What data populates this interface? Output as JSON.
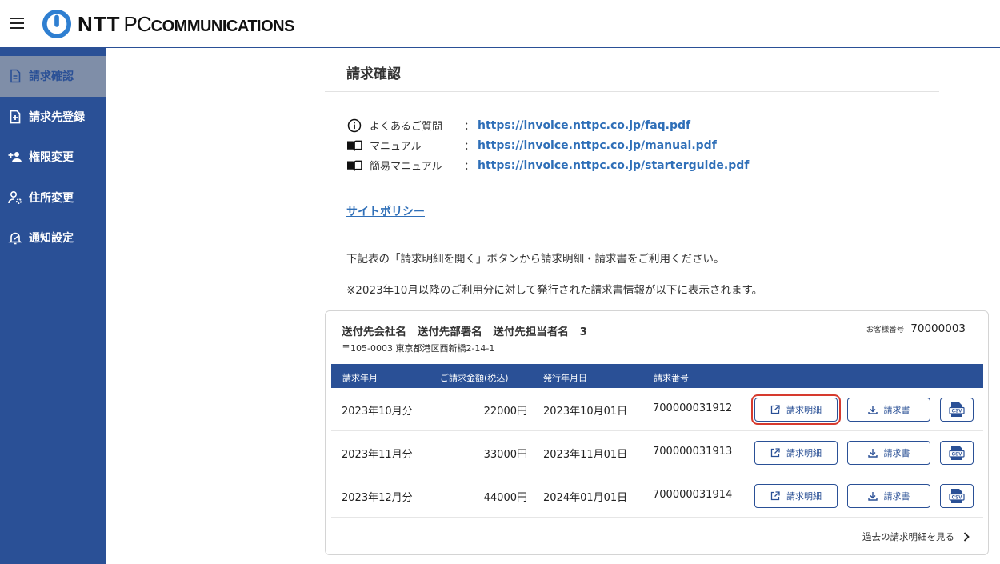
{
  "header": {
    "logo_ntt": "NTT",
    "logo_pc": "PC",
    "logo_comm": "COMMUNICATIONS"
  },
  "sidebar": {
    "items": [
      {
        "label": "請求確認",
        "icon": "document-icon"
      },
      {
        "label": "請求先登録",
        "icon": "add-document-icon"
      },
      {
        "label": "権限変更",
        "icon": "add-user-icon"
      },
      {
        "label": "住所変更",
        "icon": "user-settings-icon"
      },
      {
        "label": "通知設定",
        "icon": "bell-icon"
      }
    ]
  },
  "main": {
    "title": "請求確認",
    "links": [
      {
        "label": "よくあるご質問",
        "sep": "：",
        "url": "https://invoice.nttpc.co.jp/faq.pdf",
        "icon": "info-icon"
      },
      {
        "label": "マニュアル",
        "sep": "：",
        "url": "https://invoice.nttpc.co.jp/manual.pdf",
        "icon": "book-icon"
      },
      {
        "label": "簡易マニュアル",
        "sep": "：",
        "url": "https://invoice.nttpc.co.jp/starterguide.pdf",
        "icon": "book-icon"
      }
    ],
    "policy": "サイトポリシー",
    "note1": "下記表の「請求明細を開く」ボタンから請求明細・請求書をご利用ください。",
    "note2": "※2023年10月以降のご利用分に対して発行された請求書情報が以下に表示されます。"
  },
  "card": {
    "company": "送付先会社名",
    "dept": "送付先部署名",
    "person": "送付先担当者名",
    "person_num": "3",
    "address": "〒105-0003 東京都港区西新橋2-14-1",
    "customer_label": "お客様番号",
    "customer_number": "70000003",
    "columns": [
      "請求年月",
      "ご請求金額(税込)",
      "発行年月日",
      "請求番号"
    ],
    "detail_label": "請求明細",
    "invoice_label": "請求書",
    "csv_label": "CSV",
    "rows": [
      {
        "month": "2023年10月分",
        "amount": "22000円",
        "issued": "2023年10月01日",
        "number": "700000031912"
      },
      {
        "month": "2023年11月分",
        "amount": "33000円",
        "issued": "2023年11月01日",
        "number": "700000031913"
      },
      {
        "month": "2023年12月分",
        "amount": "44000円",
        "issued": "2024年01月01日",
        "number": "700000031914"
      }
    ],
    "past_link": "過去の請求明細を見る"
  },
  "colors": {
    "brand": "#2a5096",
    "link": "#2f6fb8",
    "highlight": "#d63a2e",
    "sidebar_active": "#7f8ea8"
  }
}
